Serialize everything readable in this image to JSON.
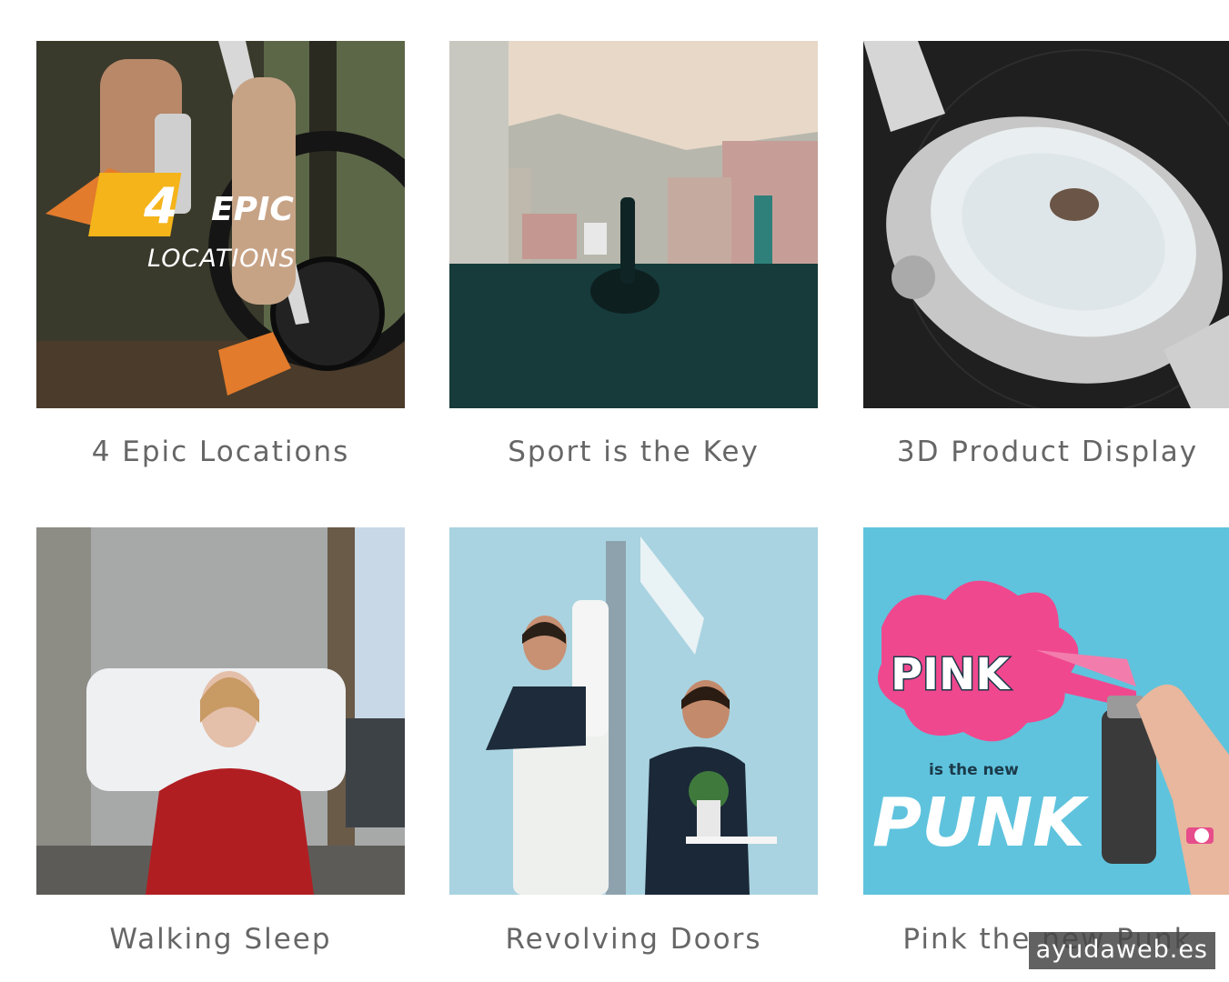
{
  "portfolio": {
    "items": [
      {
        "title": "4 Epic Locations",
        "overlay": {
          "number": "4",
          "line1": "EPIC",
          "line2": "LOCATIONS"
        }
      },
      {
        "title": "Sport is the Key"
      },
      {
        "title": "3D Product Display"
      },
      {
        "title": "Walking Sleep"
      },
      {
        "title": "Revolving Doors"
      },
      {
        "title": "Pink the new Punk",
        "overlay": {
          "word1": "PINK",
          "middle": "is the new",
          "word2": "PUNK"
        }
      }
    ]
  },
  "watermark": "ayudaweb.es",
  "colors": {
    "title_text": "#666666",
    "accent_yellow": "#f4b41a",
    "pink": "#f0488e",
    "sky_blue": "#5fc3dd"
  }
}
